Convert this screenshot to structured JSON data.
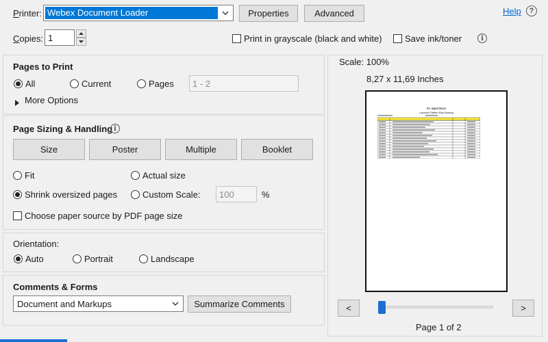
{
  "header": {
    "printer_label": "Printer:",
    "printer_value": "Webex Document Loader",
    "properties_label": "Properties",
    "advanced_label": "Advanced",
    "help_label": "Help",
    "copies_label": "Copies:",
    "copies_value": "1",
    "grayscale_label": "Print in grayscale (black and white)",
    "save_ink_label": "Save ink/toner"
  },
  "pages_to_print": {
    "title": "Pages to Print",
    "all_label": "All",
    "current_label": "Current",
    "pages_label": "Pages",
    "pages_range": "1 - 2",
    "more_options_label": "More Options",
    "selected": "all"
  },
  "page_sizing": {
    "title": "Page Sizing & Handling",
    "buttons": [
      "Size",
      "Poster",
      "Multiple",
      "Booklet"
    ],
    "fit_label": "Fit",
    "actual_size_label": "Actual size",
    "shrink_label": "Shrink oversized pages",
    "custom_scale_label": "Custom Scale:",
    "custom_scale_value": "100",
    "percent_label": "%",
    "paper_source_label": "Choose paper source by PDF page size",
    "selected": "shrink"
  },
  "orientation": {
    "title": "Orientation:",
    "auto_label": "Auto",
    "portrait_label": "Portrait",
    "landscape_label": "Landscape",
    "selected": "auto"
  },
  "comments_forms": {
    "title": "Comments & Forms",
    "selected_value": "Document and Markups",
    "summarize_label": "Summarize Comments"
  },
  "preview": {
    "scale_label": "Scale: 100%",
    "size_label": "8,27 x 11,69 Inches",
    "prev_label": "<",
    "next_label": ">",
    "page_indicator": "Page 1 of 2",
    "page_position": 0.0,
    "doc_title": "PT. INDOTECH",
    "doc_subtitle": "Laporan Daftar Stok Barang",
    "accent_color": "#1c6fcf",
    "table_header_color": "#ffeb3b"
  }
}
